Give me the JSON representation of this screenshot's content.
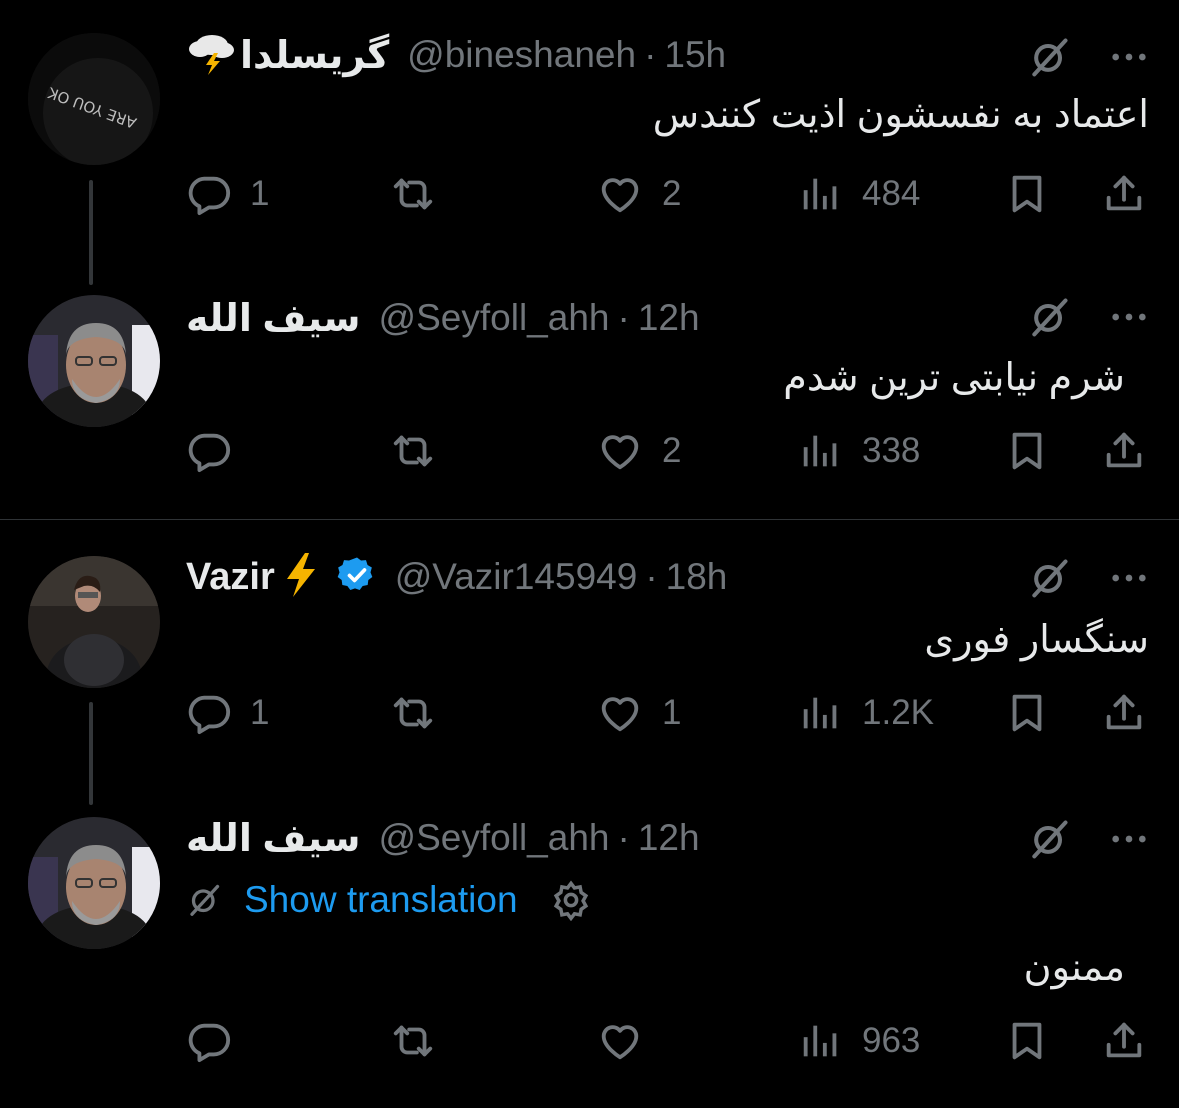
{
  "tweets": [
    {
      "name": "گریسلدا",
      "handle": "@bineshaneh",
      "time": "15h",
      "text": "اعتماد به نفسشون اذیت کنندس",
      "avatar_text": "ARE YOU OK",
      "replies": "1",
      "reposts": "",
      "likes": "2",
      "views": "484"
    },
    {
      "name": "سیف الله",
      "handle": "@Seyfoll_ahh",
      "time": "12h",
      "text": "شرم نیابتی ترین شدم",
      "replies": "",
      "reposts": "",
      "likes": "2",
      "views": "338"
    },
    {
      "name": "Vazir",
      "handle": "@Vazir145949",
      "time": "18h",
      "text": "سنگسار فوری",
      "replies": "1",
      "reposts": "",
      "likes": "1",
      "views": "1.2K"
    },
    {
      "name": "سیف الله",
      "handle": "@Seyfoll_ahh",
      "time": "12h",
      "translation_label": "Show translation",
      "text": "ممنون",
      "replies": "",
      "reposts": "",
      "likes": "",
      "views": "963"
    }
  ],
  "ui": {
    "dot": "·",
    "colors": {
      "background": "#000000",
      "text": "#e7e9ea",
      "muted": "#71767b",
      "accent": "#1d9bf0",
      "divider": "#2f3336"
    },
    "icons": [
      "reply-icon",
      "repost-icon",
      "like-icon",
      "views-icon",
      "bookmark-icon",
      "share-icon",
      "grok-icon",
      "more-icon",
      "verified-icon",
      "gear-icon",
      "lightning-icon",
      "cloud-lightning-icon"
    ]
  }
}
